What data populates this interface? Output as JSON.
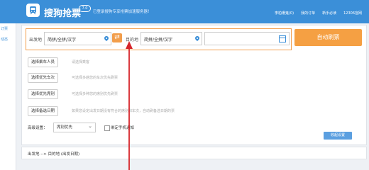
{
  "header": {
    "app_title": "搜狗抢票",
    "version": "7.0",
    "slogan": "已登录搜狗专享抢票加速服务器！",
    "links": [
      "李柏珊鬼(0)",
      "我的订单",
      "新手必读",
      "12306官网"
    ]
  },
  "left_panel": {
    "items": [
      "订票",
      "动态"
    ]
  },
  "route": {
    "from_label": "出发地",
    "from_value": "简拼/全拼/汉字",
    "to_label": "目的地",
    "to_value": "简拼/全拼/汉字",
    "date_value": "",
    "auto_button": "自动刷票"
  },
  "options": [
    {
      "button": "选择乘车人员",
      "hint": "请选择乘客"
    },
    {
      "button": "选择优先车次",
      "hint": "可选择多趟您的车次优先刷票"
    },
    {
      "button": "选择优先席别",
      "hint": "可选择多种您的席别优先刷票"
    },
    {
      "button": "选择备选日期",
      "hint": "如果您设定出发日期没有符合的席别和车次，自动刷备选日期的票"
    }
  ],
  "advanced": {
    "label": "高级设置：",
    "select_value": "席别优先",
    "checkbox_label": "绑定手机通知"
  },
  "collapse_label": "收起设置",
  "footer": {
    "route_text": "出发地 --> 目的地 (出发日期)"
  },
  "colors": {
    "primary": "#3b8fd8",
    "accent": "#f5a043"
  }
}
